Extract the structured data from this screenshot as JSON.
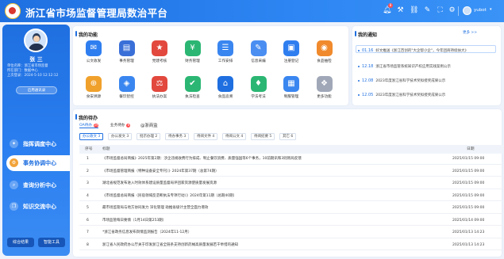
{
  "header": {
    "title": "浙江省市场监督管理局数治平台",
    "bell_badge": "8",
    "user": "yubot",
    "icons": [
      "bell-icon",
      "wrench-icon",
      "link-icon",
      "pencil-icon",
      "fullscreen-icon",
      "gear-icon"
    ]
  },
  "sidebar": {
    "name": "张 三",
    "info": [
      "单位名称：浙江省市场监督",
      "所在部门：数据中心",
      "上次登录：2024-5-10 12:12:12"
    ],
    "action_button": "启用通讯录",
    "nav": [
      {
        "label": "指挥调度中心",
        "active": false
      },
      {
        "label": "事务协调中心",
        "active": true
      },
      {
        "label": "查询分析中心",
        "active": false
      },
      {
        "label": "知识交流中心",
        "active": false
      }
    ],
    "bottom_buttons": [
      "综合结果",
      "智能工具"
    ]
  },
  "functions": {
    "title": "我的功能",
    "items": [
      {
        "label": "公文收发",
        "color": "#2f7ef0",
        "icon": "✉"
      },
      {
        "label": "事务管理",
        "color": "#3a6fd8",
        "icon": "▤"
      },
      {
        "label": "党建考核",
        "color": "#e2483d",
        "icon": "★"
      },
      {
        "label": "财务管理",
        "color": "#2bb673",
        "icon": "¥"
      },
      {
        "label": "工作安排",
        "color": "#3a86f0",
        "icon": "☰"
      },
      {
        "label": "信息采编",
        "color": "#4a8ef2",
        "icon": "✎"
      },
      {
        "label": "注册登记",
        "color": "#2f7ef0",
        "icon": "▣"
      },
      {
        "label": "食品抽检",
        "color": "#f08a2c",
        "icon": "◉"
      },
      {
        "label": "食安溯源",
        "color": "#f0a12c",
        "icon": "⊕"
      },
      {
        "label": "餐饮智控",
        "color": "#3a86f0",
        "icon": "◈"
      },
      {
        "label": "执法办案",
        "color": "#e2483d",
        "icon": "⚖"
      },
      {
        "label": "执法检查",
        "color": "#2bb673",
        "icon": "✔"
      },
      {
        "label": "食品追溯",
        "color": "#1f6fe0",
        "icon": "⌂"
      },
      {
        "label": "学法考法",
        "color": "#2bb673",
        "icon": "♦"
      },
      {
        "label": "制服管理",
        "color": "#3a86f0",
        "icon": "▦"
      },
      {
        "label": "更多功能",
        "color": "#a0a8b8",
        "icon": "❖"
      }
    ]
  },
  "notices": {
    "title": "我的通知",
    "more": "更多 >>",
    "items": [
      {
        "date": "01.16",
        "text": "好文推送《浙江百创的\"大企帮小企\"，今年团商持续扶大》"
      },
      {
        "date": "12.18",
        "text": "浙江省市场监管系统知识产权应用实践案例公示"
      },
      {
        "date": "12.08",
        "text": "2023年度浙江省科学技术奖拟授奖成果公示"
      },
      {
        "date": "12.05",
        "text": "2023年度浙江省科学技术奖拟授奖成果公示"
      }
    ]
  },
  "todo": {
    "title": "我的待办",
    "main_tabs": [
      {
        "label": "OA待办",
        "badge": "29"
      },
      {
        "label": "业务待办",
        "badge": "6"
      },
      {
        "label": "@浙商监",
        "badge": ""
      }
    ],
    "sub_tabs": [
      "办公收文 3",
      "办公发文 3",
      "批示办理 2",
      "待办事务 3",
      "待阅文件 4",
      "待阅公文 4",
      "待阅纪要 5",
      "其它 6"
    ],
    "columns": {
      "no": "序号",
      "title": "标题",
      "date": "日期"
    },
    "rows": [
      {
        "no": "1",
        "title": "《市场监督总局简报》2025年第2期：涉企违规收费行为排成、制止餐饮浪费、质量强国等6个事务，10前期讯和3则周局反馈",
        "date": "2025/01/15 09:00"
      },
      {
        "no": "2",
        "title": "《市场监督管理简报（特种设备安全专刊）》2024年第37期（总第74期）",
        "date": "2025/01/15 09:00"
      },
      {
        "no": "3",
        "title": "湖北省规范发布进入时效体系建设质量监督局评团家资源使质量发展资源",
        "date": "2025/01/15 09:00"
      },
      {
        "no": "4",
        "title": "《市场监督总局简报（民宿领域反垄断执法专项行动）》2024年第11期（总期40期）",
        "date": "2025/01/15 09:00"
      },
      {
        "no": "5",
        "title": "最市场监管局与地方协同发力 深化管理 助推省级计主营全面力增效",
        "date": "2025/01/15 09:00"
      },
      {
        "no": "6",
        "title": "市场监管每日要情（1月14日第253期）",
        "date": "2025/01/14 09:00"
      },
      {
        "no": "7",
        "title": "*浙江省政务信息发布舆情监测报告（2024年11-12月）",
        "date": "2025/01/13 14:23"
      },
      {
        "no": "8",
        "title": "浙江省人民政府办公厅关于印发浙江省全链条支持创新药械高质量发展若干举措的通知",
        "date": "2025/01/13 14:23"
      }
    ]
  }
}
